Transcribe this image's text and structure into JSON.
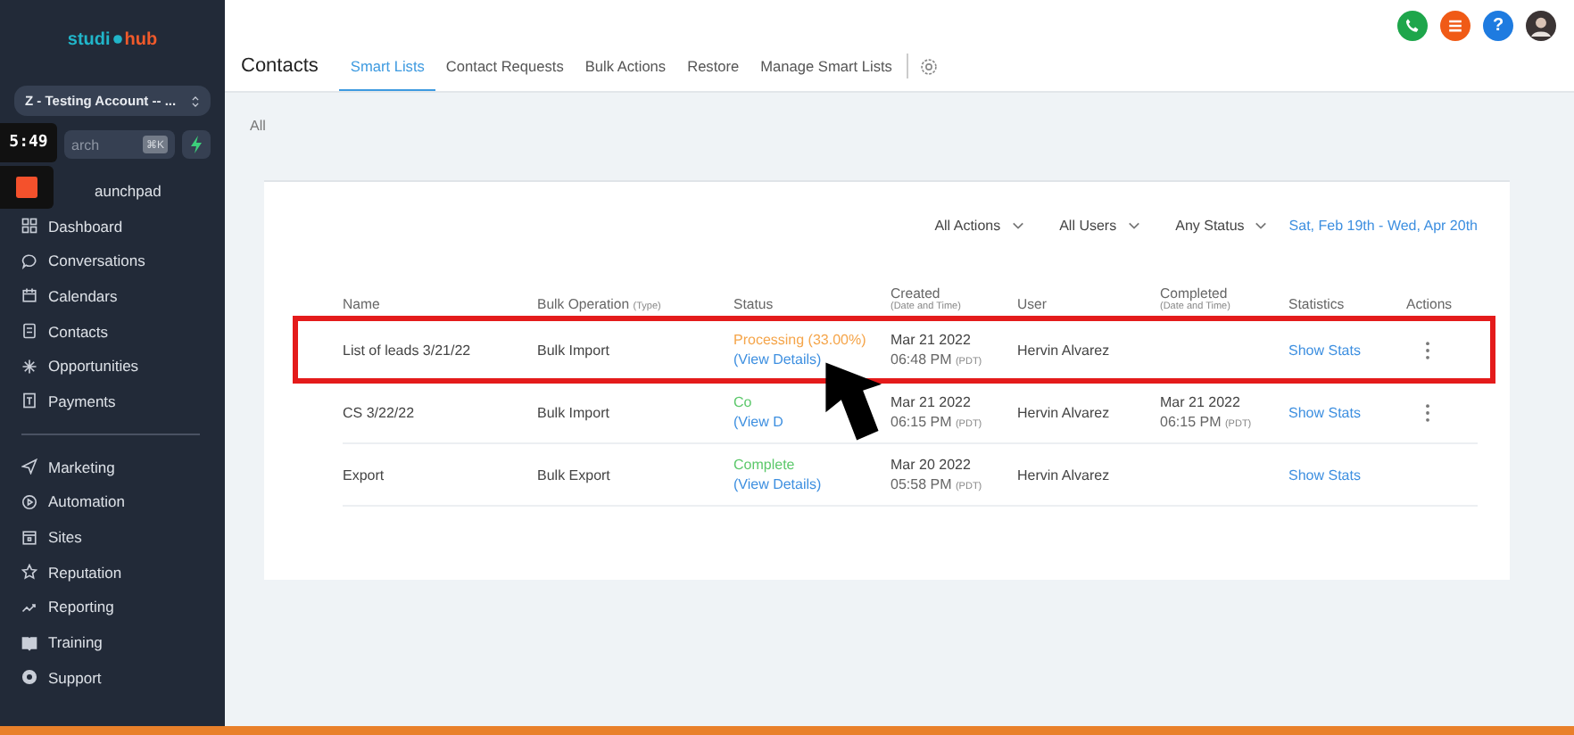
{
  "sidebar": {
    "logo": {
      "left": "studi",
      "right": "hub"
    },
    "account": "Z - Testing Account -- ...",
    "search": {
      "placeholder": "arch",
      "shortcut": "⌘K"
    },
    "items": [
      {
        "label": "aunchpad"
      },
      {
        "label": "Dashboard"
      },
      {
        "label": "Conversations"
      },
      {
        "label": "Calendars"
      },
      {
        "label": "Contacts"
      },
      {
        "label": "Opportunities"
      },
      {
        "label": "Payments"
      }
    ],
    "items_2": [
      {
        "label": "Marketing"
      },
      {
        "label": "Automation"
      },
      {
        "label": "Sites"
      },
      {
        "label": "Reputation"
      },
      {
        "label": "Reporting"
      },
      {
        "label": "Training"
      },
      {
        "label": "Support"
      }
    ]
  },
  "recording_overlay": {
    "timer": "5:49"
  },
  "header": {
    "title": "Contacts",
    "help": "?",
    "tabs": [
      {
        "label": "Smart Lists",
        "selected": true
      },
      {
        "label": "Contact Requests",
        "selected": false
      },
      {
        "label": "Bulk Actions",
        "selected": false
      },
      {
        "label": "Restore",
        "selected": false
      },
      {
        "label": "Manage Smart Lists",
        "selected": false
      }
    ]
  },
  "breadcrumb": "All",
  "filters": [
    {
      "label": "All Actions"
    },
    {
      "label": "All Users"
    },
    {
      "label": "Any Status"
    }
  ],
  "date_range": "Sat, Feb 19th - Wed, Apr 20th",
  "table": {
    "columns": [
      {
        "label": "Name"
      },
      {
        "label": "Bulk Operation",
        "sub": "(Type)"
      },
      {
        "label": "Status"
      },
      {
        "label": "Created",
        "sub": "(Date and Time)"
      },
      {
        "label": "User"
      },
      {
        "label": "Completed",
        "sub": "(Date and Time)"
      },
      {
        "label": "Statistics"
      },
      {
        "label": "Actions"
      }
    ],
    "rows": [
      {
        "name": "List of leads 3/21/22",
        "operation": "Bulk Import",
        "status": {
          "kind": "processing",
          "text": "Processing (33.00%)"
        },
        "details": "(View Details)",
        "created": {
          "date": "Mar 21 2022",
          "time": "06:48 PM",
          "tz": "(PDT)"
        },
        "user": "Hervin Alvarez",
        "stats": "Show Stats",
        "menu": true,
        "highlighted": true
      },
      {
        "name": "CS 3/22/22",
        "operation": "Bulk Import",
        "status": {
          "kind": "complete",
          "text": "Co"
        },
        "details": "(View D",
        "created": {
          "date": "Mar 21 2022",
          "time": "06:15 PM",
          "tz": "(PDT)"
        },
        "user": "Hervin Alvarez",
        "completed": {
          "date": "Mar 21 2022",
          "time": "06:15 PM",
          "tz": "(PDT)"
        },
        "stats": "Show Stats",
        "menu": true,
        "highlighted": false
      },
      {
        "name": "Export",
        "operation": "Bulk Export",
        "status": {
          "kind": "complete",
          "text": "Complete"
        },
        "details": "(View Details)",
        "created": {
          "date": "Mar 20 2022",
          "time": "05:58 PM",
          "tz": "(PDT)"
        },
        "user": "Hervin Alvarez",
        "stats": "Show Stats",
        "menu": false,
        "highlighted": false
      }
    ]
  }
}
